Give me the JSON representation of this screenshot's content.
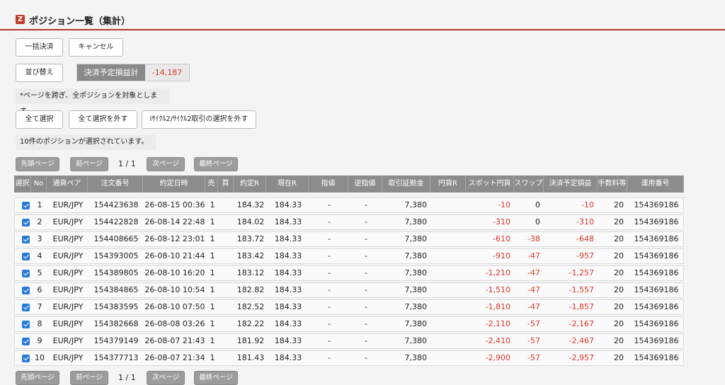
{
  "page": {
    "logo_glyph": "Z",
    "title": "ポジション一覧（集計）"
  },
  "actions": {
    "bulk_settle": "一括決済",
    "cancel": "キャンセル",
    "sort": "並び替え"
  },
  "summary": {
    "label": "決済予定損益計",
    "value": "-14,187"
  },
  "notes": {
    "page_scope": "*ページを跨ぎ、全ポジションを対象とします。",
    "selected_count": "10件のポジションが選択されています。"
  },
  "selection": {
    "select_all": "全て選択",
    "deselect_all": "全て選択を外す",
    "deselect_cycle": "iｻｲｸﾙ2/ｻｲｸﾙ2取引の選択を外す"
  },
  "pagination": {
    "first": "先頭ページ",
    "prev": "前ページ",
    "info": "1 / 1",
    "next": "次ページ",
    "last": "最終ページ"
  },
  "table": {
    "headers": [
      "選択",
      "No",
      "通貨ペア",
      "注文番号",
      "約定日時",
      "売",
      "買",
      "約定R",
      "現在R",
      "指値",
      "逆指値",
      "取引証拠金",
      "円貨R",
      "スポット円貨",
      "スワップ",
      "決済予定損益",
      "手数料等",
      "運用番号"
    ],
    "rows": [
      {
        "no": "1",
        "pair": "EUR/JPY",
        "order": "154423638",
        "datetime": "26-08-15 00:36",
        "sell": "1",
        "buy": "",
        "exec_rate": "184.32",
        "cur_rate": "184.33",
        "limit": "-",
        "stop": "-",
        "margin": "7,380",
        "yen_rate": "",
        "spot_yen": "-10",
        "swap": "0",
        "pnl": "-10",
        "fee": "20",
        "op_no": "154369186"
      },
      {
        "no": "2",
        "pair": "EUR/JPY",
        "order": "154422828",
        "datetime": "26-08-14 22:48",
        "sell": "1",
        "buy": "",
        "exec_rate": "184.02",
        "cur_rate": "184.33",
        "limit": "-",
        "stop": "-",
        "margin": "7,380",
        "yen_rate": "",
        "spot_yen": "-310",
        "swap": "0",
        "pnl": "-310",
        "fee": "20",
        "op_no": "154369186"
      },
      {
        "no": "3",
        "pair": "EUR/JPY",
        "order": "154408665",
        "datetime": "26-08-12 23:01",
        "sell": "1",
        "buy": "",
        "exec_rate": "183.72",
        "cur_rate": "184.33",
        "limit": "-",
        "stop": "-",
        "margin": "7,380",
        "yen_rate": "",
        "spot_yen": "-610",
        "swap": "-38",
        "pnl": "-648",
        "fee": "20",
        "op_no": "154369186"
      },
      {
        "no": "4",
        "pair": "EUR/JPY",
        "order": "154393005",
        "datetime": "26-08-10 21:44",
        "sell": "1",
        "buy": "",
        "exec_rate": "183.42",
        "cur_rate": "184.33",
        "limit": "-",
        "stop": "-",
        "margin": "7,380",
        "yen_rate": "",
        "spot_yen": "-910",
        "swap": "-47",
        "pnl": "-957",
        "fee": "20",
        "op_no": "154369186"
      },
      {
        "no": "5",
        "pair": "EUR/JPY",
        "order": "154389805",
        "datetime": "26-08-10 16:20",
        "sell": "1",
        "buy": "",
        "exec_rate": "183.12",
        "cur_rate": "184.33",
        "limit": "-",
        "stop": "-",
        "margin": "7,380",
        "yen_rate": "",
        "spot_yen": "-1,210",
        "swap": "-47",
        "pnl": "-1,257",
        "fee": "20",
        "op_no": "154369186"
      },
      {
        "no": "6",
        "pair": "EUR/JPY",
        "order": "154384865",
        "datetime": "26-08-10 10:54",
        "sell": "1",
        "buy": "",
        "exec_rate": "182.82",
        "cur_rate": "184.33",
        "limit": "-",
        "stop": "-",
        "margin": "7,380",
        "yen_rate": "",
        "spot_yen": "-1,510",
        "swap": "-47",
        "pnl": "-1,557",
        "fee": "20",
        "op_no": "154369186"
      },
      {
        "no": "7",
        "pair": "EUR/JPY",
        "order": "154383595",
        "datetime": "26-08-10 07:50",
        "sell": "1",
        "buy": "",
        "exec_rate": "182.52",
        "cur_rate": "184.33",
        "limit": "-",
        "stop": "-",
        "margin": "7,380",
        "yen_rate": "",
        "spot_yen": "-1,810",
        "swap": "-47",
        "pnl": "-1,857",
        "fee": "20",
        "op_no": "154369186"
      },
      {
        "no": "8",
        "pair": "EUR/JPY",
        "order": "154382668",
        "datetime": "26-08-08 03:26",
        "sell": "1",
        "buy": "",
        "exec_rate": "182.22",
        "cur_rate": "184.33",
        "limit": "-",
        "stop": "-",
        "margin": "7,380",
        "yen_rate": "",
        "spot_yen": "-2,110",
        "swap": "-57",
        "pnl": "-2,167",
        "fee": "20",
        "op_no": "154369186"
      },
      {
        "no": "9",
        "pair": "EUR/JPY",
        "order": "154379149",
        "datetime": "26-08-07 21:43",
        "sell": "1",
        "buy": "",
        "exec_rate": "181.92",
        "cur_rate": "184.33",
        "limit": "-",
        "stop": "-",
        "margin": "7,380",
        "yen_rate": "",
        "spot_yen": "-2,410",
        "swap": "-57",
        "pnl": "-2,467",
        "fee": "20",
        "op_no": "154369186"
      },
      {
        "no": "10",
        "pair": "EUR/JPY",
        "order": "154377713",
        "datetime": "26-08-07 21:34",
        "sell": "1",
        "buy": "",
        "exec_rate": "181.43",
        "cur_rate": "184.33",
        "limit": "-",
        "stop": "-",
        "margin": "7,380",
        "yen_rate": "",
        "spot_yen": "-2,900",
        "swap": "-57",
        "pnl": "-2,957",
        "fee": "20",
        "op_no": "154369186"
      }
    ]
  },
  "colors": {
    "accent": "#b03a2e",
    "negative": "#d9352b",
    "checkbox": "#2b7bd6",
    "header_bg": "#8c8c8c"
  },
  "icons": {
    "logo": "brand-logo-icon",
    "checkbox": "checkbox-checked-icon"
  }
}
